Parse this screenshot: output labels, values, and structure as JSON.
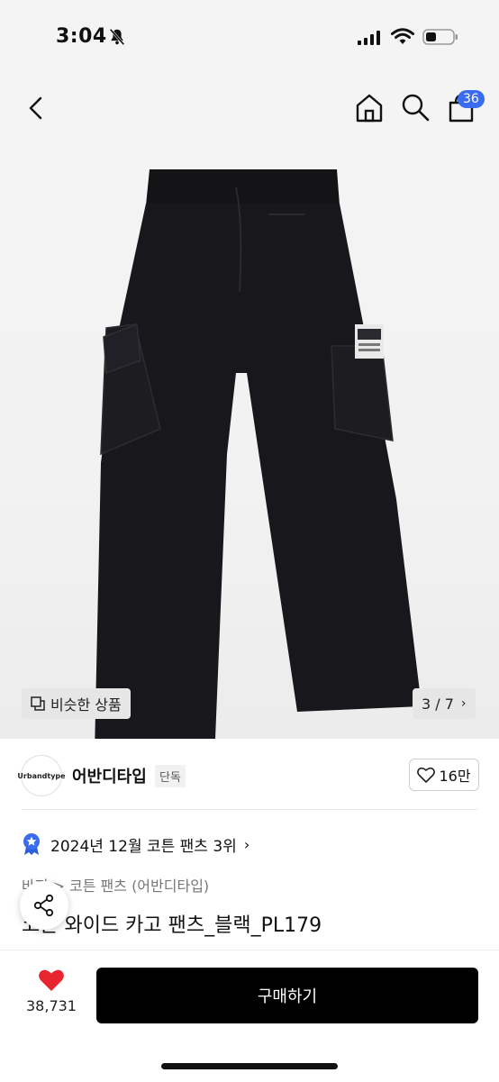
{
  "status_bar": {
    "time": "3:04"
  },
  "nav": {
    "cart_count": "36"
  },
  "gallery": {
    "similar_label": "비슷한 상품",
    "page_indicator": "3 / 7"
  },
  "brand": {
    "logo_text": "Urbandtype",
    "name": "어반디타입",
    "exclusive_badge": "단독",
    "like_count": "16만"
  },
  "ranking": {
    "text": "2024년 12월 코튼 팬츠 3위"
  },
  "breadcrumb": {
    "text": "바지 > 코튼 팬츠 (어반디타입)"
  },
  "product": {
    "title": "코튼 와이드 카고 팬츠_블랙_PL179"
  },
  "bottom_bar": {
    "favorite_count": "38,731",
    "buy_label": "구매하기"
  },
  "colors": {
    "accent": "#3a6cf0",
    "heart": "#e8252f",
    "buy_button": "#000000"
  }
}
